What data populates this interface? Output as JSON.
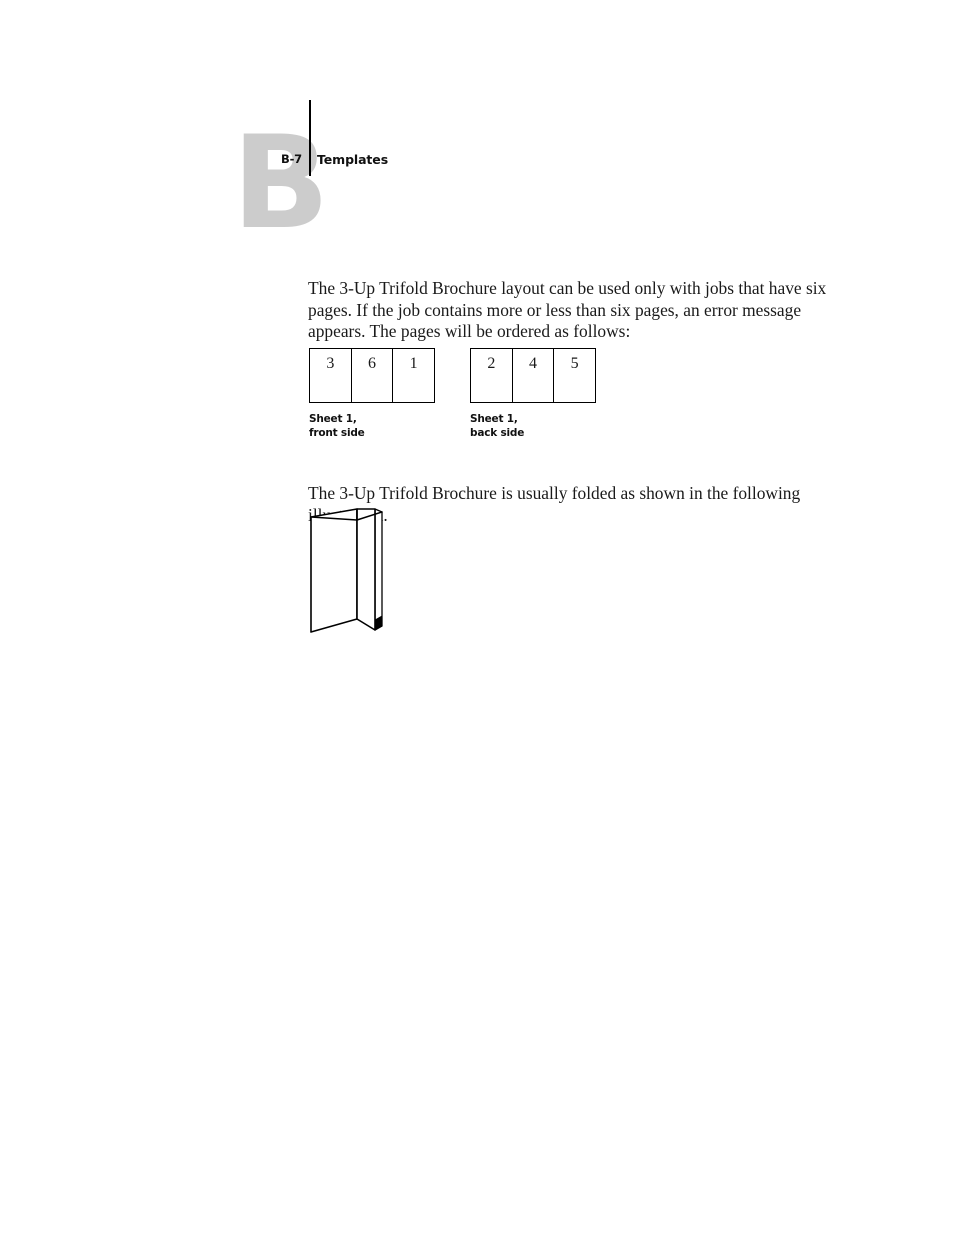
{
  "page": {
    "chapter_letter": "B",
    "folio": "B-7",
    "running_head": "Templates"
  },
  "content": {
    "intro_paragraph": "The 3-Up Trifold Brochure layout can be used only with jobs that have six pages. If the job contains more or less than six pages, an error message appears. The pages will be ordered as follows:",
    "fold_paragraph": "The 3-Up Trifold Brochure is usually folded as shown in the following illustration."
  },
  "imposition": {
    "front": {
      "cells": [
        "3",
        "6",
        "1"
      ],
      "caption": "Sheet 1,\nfront side"
    },
    "back": {
      "cells": [
        "2",
        "4",
        "5"
      ],
      "caption": "Sheet 1,\nback side"
    }
  },
  "illustration": {
    "name": "folded-trifold-brochure"
  },
  "colors": {
    "chapter_letter_gray": "#cccccc",
    "ink": "#000000",
    "body_text": "#1a1a1a",
    "page_background": "#ffffff"
  }
}
